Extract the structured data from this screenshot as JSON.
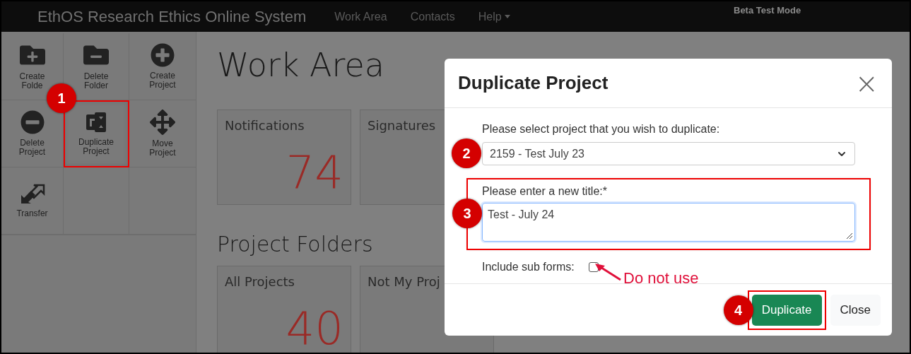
{
  "navbar": {
    "brand": "EthOS Research Ethics Online System",
    "links": [
      {
        "label": "Work Area",
        "kind": "link"
      },
      {
        "label": "Contacts",
        "kind": "link"
      },
      {
        "label": "Help",
        "kind": "dropdown"
      }
    ],
    "mode": "Beta Test Mode"
  },
  "toolbar": [
    {
      "label": "Create Folde"
    },
    {
      "label": "Delete Folder"
    },
    {
      "label": "Create Project"
    },
    {
      "label": "Delete Project"
    },
    {
      "label": "Duplicate Project",
      "step": "1"
    },
    {
      "label": "Move Project"
    },
    {
      "label": "Transfer"
    }
  ],
  "work_area": {
    "heading": "Work Area",
    "cards": [
      {
        "title": "Notifications",
        "count": "74",
        "color": "#9a2a26"
      },
      {
        "title": "Signatures"
      }
    ]
  },
  "project_folders": {
    "heading": "Project Folders",
    "cards": [
      {
        "title": "All Projects",
        "count": "40",
        "color": "#9a2a26"
      },
      {
        "title": "Not My Proj"
      }
    ]
  },
  "modal": {
    "title": "Duplicate Project",
    "close": "×",
    "project_select": {
      "label": "Please select project that you wish to duplicate:",
      "value": "2159 - Test July 23",
      "step": "2"
    },
    "title_field": {
      "label": "Please enter a new title:*",
      "value": "Test - July 24",
      "step": "3"
    },
    "sub_forms": {
      "label": "Include sub forms:",
      "checked": false,
      "note": "Do not use"
    },
    "buttons": [
      {
        "label": "Duplicate",
        "kind": "primary",
        "step": "4"
      },
      {
        "label": "Close",
        "kind": "secondary"
      }
    ]
  }
}
